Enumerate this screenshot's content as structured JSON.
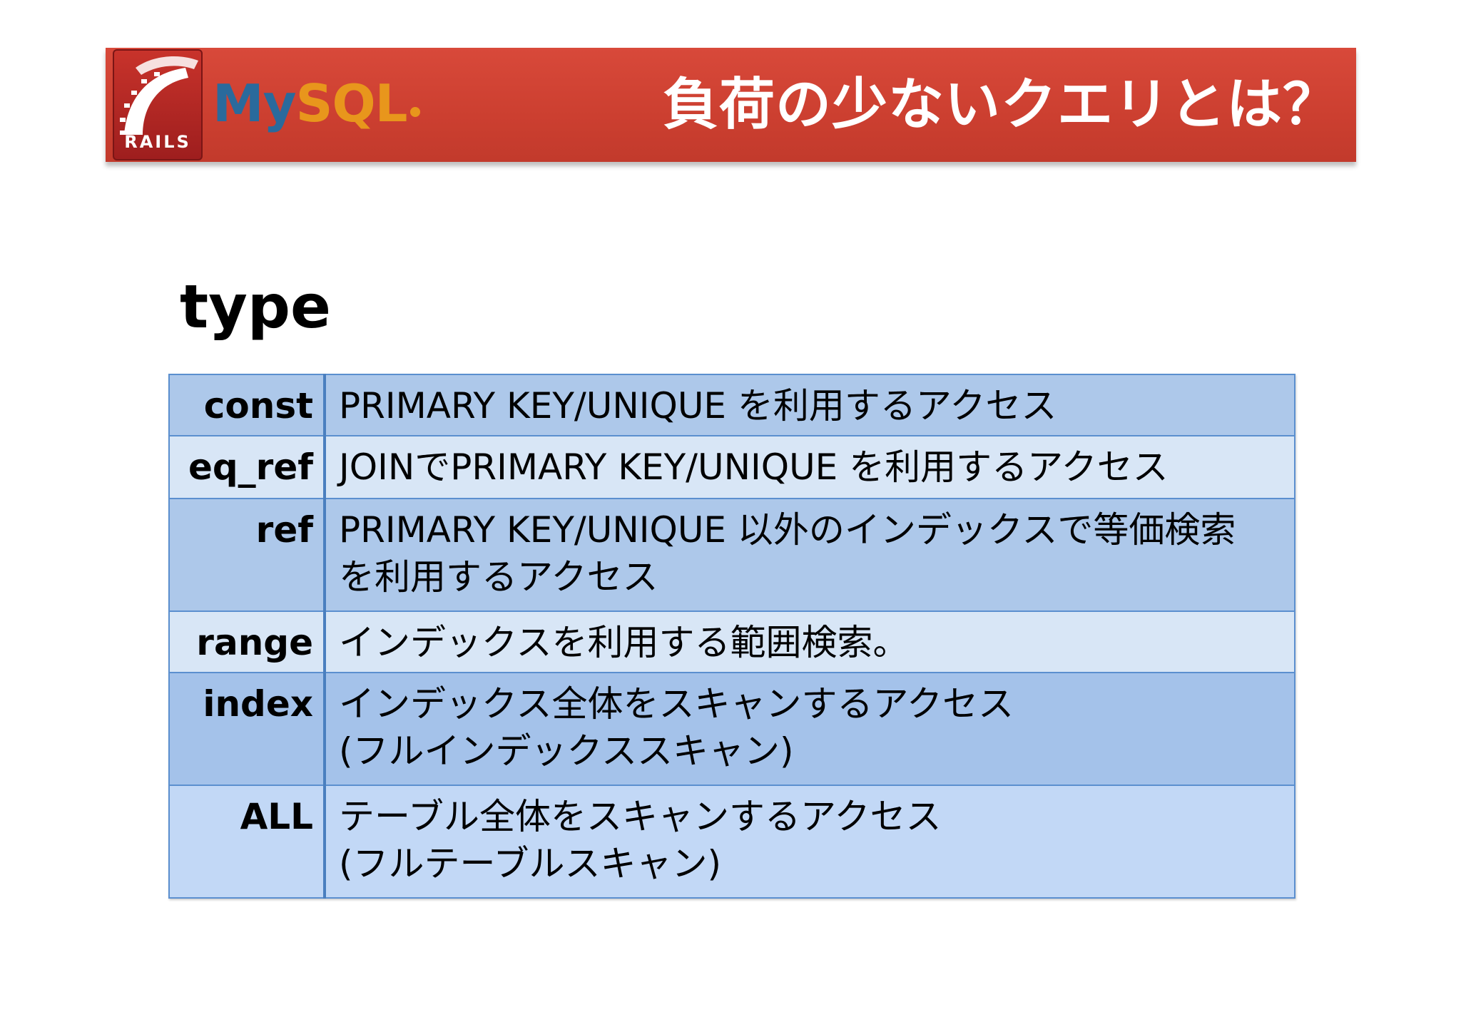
{
  "header": {
    "rails_logo_text": "RAILS",
    "mysql_logo": {
      "my": "My",
      "sql": "SQL"
    },
    "title": "負荷の少ないクエリとは？",
    "colors": {
      "bar": "#cc3f30",
      "mysql_blue": "#2a6a9c",
      "mysql_orange": "#e8961c"
    }
  },
  "section": {
    "heading": "type"
  },
  "table": {
    "rows": [
      {
        "key": "const",
        "lines": [
          "PRIMARY KEY/UNIQUE を利用するアクセス"
        ],
        "highlight": false
      },
      {
        "key": "eq_ref",
        "lines": [
          "JOINでPRIMARY KEY/UNIQUE を利用するアクセス"
        ],
        "highlight": false
      },
      {
        "key": "ref",
        "lines": [
          "PRIMARY KEY/UNIQUE 以外のインデックスで等価検索",
          "を利用するアクセス"
        ],
        "highlight": false
      },
      {
        "key": "range",
        "lines": [
          "インデックスを利用する範囲検索。"
        ],
        "highlight": false
      },
      {
        "key": "index",
        "lines": [
          "インデックス全体をスキャンするアクセス",
          "(フルインデックススキャン)"
        ],
        "highlight": true
      },
      {
        "key": "ALL",
        "lines": [
          "テーブル全体をスキャンするアクセス",
          "(フルテーブルスキャン)"
        ],
        "highlight": true
      }
    ],
    "colors": {
      "highlight_text": "#e01010",
      "border": "#5b8fcf"
    }
  }
}
